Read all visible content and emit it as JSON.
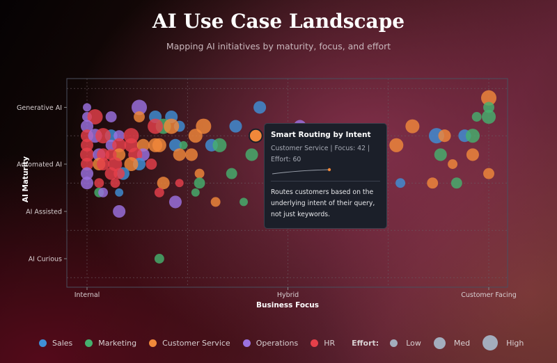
{
  "title": "AI Use Case Landscape",
  "subtitle": "Mapping AI initiatives by maturity, focus, and effort",
  "chart_data": {
    "type": "scatter",
    "title": "AI Use Case Landscape",
    "subtitle": "Mapping AI initiatives by maturity, focus, and effort",
    "xlabel": "Business Focus",
    "ylabel": "AI Maturity",
    "x_ticks": [
      {
        "value": 0,
        "label": "Internal"
      },
      {
        "value": 50,
        "label": "Hybrid"
      },
      {
        "value": 100,
        "label": "Customer Facing"
      }
    ],
    "y_ticks": [
      {
        "value": 1,
        "label": "AI Curious"
      },
      {
        "value": 2,
        "label": "AI Assisted"
      },
      {
        "value": 3,
        "label": "Automated AI"
      },
      {
        "value": 4.2,
        "label": "Generative AI"
      }
    ],
    "grid": true,
    "size_encoding": "effort",
    "colors": {
      "Sales": "#3f8fd6",
      "Marketing": "#45b06e",
      "Customer Service": "#f0883a",
      "Operations": "#9b72e0",
      "HR": "#e5404a"
    },
    "points": [
      {
        "dept": "Operations",
        "focus": 0,
        "maturity": 4.2,
        "effort": 22
      },
      {
        "dept": "Operations",
        "focus": 0,
        "maturity": 4.0,
        "effort": 33
      },
      {
        "dept": "HR",
        "focus": 2,
        "maturity": 4.0,
        "effort": 78
      },
      {
        "dept": "Operations",
        "focus": 6,
        "maturity": 4.0,
        "effort": 44
      },
      {
        "dept": "Operations",
        "focus": 13,
        "maturity": 4.2,
        "effort": 78
      },
      {
        "dept": "Customer Service",
        "focus": 13,
        "maturity": 4.0,
        "effort": 44
      },
      {
        "dept": "Sales",
        "focus": 17,
        "maturity": 4.0,
        "effort": 56
      },
      {
        "dept": "Sales",
        "focus": 21,
        "maturity": 4.0,
        "effort": 56
      },
      {
        "dept": "Sales",
        "focus": 43,
        "maturity": 4.2,
        "effort": 56
      },
      {
        "dept": "Operations",
        "focus": 0,
        "maturity": 3.8,
        "effort": 56
      },
      {
        "dept": "Sales",
        "focus": 23,
        "maturity": 3.8,
        "effort": 44
      },
      {
        "dept": "Marketing",
        "focus": 19,
        "maturity": 3.8,
        "effort": 78
      },
      {
        "dept": "HR",
        "focus": 17,
        "maturity": 3.8,
        "effort": 78
      },
      {
        "dept": "Customer Service",
        "focus": 21,
        "maturity": 3.8,
        "effort": 78
      },
      {
        "dept": "Customer Service",
        "focus": 29,
        "maturity": 3.8,
        "effort": 78
      },
      {
        "dept": "Sales",
        "focus": 37,
        "maturity": 3.8,
        "effort": 56
      },
      {
        "dept": "Operations",
        "focus": 53,
        "maturity": 3.8,
        "effort": 56
      },
      {
        "dept": "Customer Service",
        "focus": 27,
        "maturity": 3.6,
        "effort": 67
      },
      {
        "dept": "HR",
        "focus": 0,
        "maturity": 3.6,
        "effort": 56
      },
      {
        "dept": "Operations",
        "focus": 2,
        "maturity": 3.6,
        "effort": 67
      },
      {
        "dept": "Sales",
        "focus": 6,
        "maturity": 3.6,
        "effort": 56
      },
      {
        "dept": "HR",
        "focus": 4,
        "maturity": 3.6,
        "effort": 78
      },
      {
        "dept": "Operations",
        "focus": 8,
        "maturity": 3.6,
        "effort": 44
      },
      {
        "dept": "HR",
        "focus": 11,
        "maturity": 3.6,
        "effort": 78
      },
      {
        "dept": "HR",
        "focus": 0,
        "maturity": 3.4,
        "effort": 56
      },
      {
        "dept": "Operations",
        "focus": 6,
        "maturity": 3.4,
        "effort": 44
      },
      {
        "dept": "HR",
        "focus": 8,
        "maturity": 3.4,
        "effort": 67
      },
      {
        "dept": "HR",
        "focus": 11,
        "maturity": 3.4,
        "effort": 67
      },
      {
        "dept": "Customer Service",
        "focus": 14,
        "maturity": 3.4,
        "effort": 56
      },
      {
        "dept": "Customer Service",
        "focus": 17,
        "maturity": 3.4,
        "effort": 67
      },
      {
        "dept": "Customer Service",
        "focus": 18,
        "maturity": 3.4,
        "effort": 67
      },
      {
        "dept": "Sales",
        "focus": 22,
        "maturity": 3.4,
        "effort": 56
      },
      {
        "dept": "Marketing",
        "focus": 24,
        "maturity": 3.4,
        "effort": 22
      },
      {
        "dept": "Sales",
        "focus": 31,
        "maturity": 3.4,
        "effort": 56
      },
      {
        "dept": "Marketing",
        "focus": 33,
        "maturity": 3.4,
        "effort": 67
      },
      {
        "dept": "HR",
        "focus": 0,
        "maturity": 3.2,
        "effort": 67
      },
      {
        "dept": "Operations",
        "focus": 3,
        "maturity": 3.2,
        "effort": 56
      },
      {
        "dept": "HR",
        "focus": 4,
        "maturity": 3.2,
        "effort": 56
      },
      {
        "dept": "Customer Service",
        "focus": 8,
        "maturity": 3.2,
        "effort": 56
      },
      {
        "dept": "HR",
        "focus": 6,
        "maturity": 3.2,
        "effort": 44
      },
      {
        "dept": "Operations",
        "focus": 14,
        "maturity": 3.2,
        "effort": 56
      },
      {
        "dept": "HR",
        "focus": 12,
        "maturity": 3.2,
        "effort": 67
      },
      {
        "dept": "Customer Service",
        "focus": 23,
        "maturity": 3.2,
        "effort": 56
      },
      {
        "dept": "Customer Service",
        "focus": 26,
        "maturity": 3.2,
        "effort": 56
      },
      {
        "dept": "Marketing",
        "focus": 41,
        "maturity": 3.2,
        "effort": 56
      },
      {
        "dept": "HR",
        "focus": 0,
        "maturity": 3.0,
        "effort": 56
      },
      {
        "dept": "Customer Service",
        "focus": 3,
        "maturity": 3.0,
        "effort": 56
      },
      {
        "dept": "HR",
        "focus": 4,
        "maturity": 3.0,
        "effort": 56
      },
      {
        "dept": "HR",
        "focus": 7,
        "maturity": 3.0,
        "effort": 67
      },
      {
        "dept": "Sales",
        "focus": 13,
        "maturity": 3.0,
        "effort": 56
      },
      {
        "dept": "Customer Service",
        "focus": 11,
        "maturity": 3.0,
        "effort": 67
      },
      {
        "dept": "HR",
        "focus": 16,
        "maturity": 3.0,
        "effort": 44
      },
      {
        "dept": "Operations",
        "focus": 0,
        "maturity": 2.8,
        "effort": 56
      },
      {
        "dept": "Sales",
        "focus": 9,
        "maturity": 2.8,
        "effort": 56
      },
      {
        "dept": "HR",
        "focus": 6,
        "maturity": 2.8,
        "effort": 56
      },
      {
        "dept": "HR",
        "focus": 8,
        "maturity": 2.8,
        "effort": 44
      },
      {
        "dept": "Customer Service",
        "focus": 28,
        "maturity": 2.8,
        "effort": 33
      },
      {
        "dept": "Marketing",
        "focus": 36,
        "maturity": 2.8,
        "effort": 44
      },
      {
        "dept": "Operations",
        "focus": 0,
        "maturity": 2.6,
        "effort": 56
      },
      {
        "dept": "HR",
        "focus": 3,
        "maturity": 2.6,
        "effort": 33
      },
      {
        "dept": "HR",
        "focus": 7,
        "maturity": 2.6,
        "effort": 33
      },
      {
        "dept": "Customer Service",
        "focus": 19,
        "maturity": 2.6,
        "effort": 56
      },
      {
        "dept": "HR",
        "focus": 23,
        "maturity": 2.6,
        "effort": 22
      },
      {
        "dept": "Marketing",
        "focus": 28,
        "maturity": 2.6,
        "effort": 44
      },
      {
        "dept": "Marketing",
        "focus": 3,
        "maturity": 2.4,
        "effort": 33
      },
      {
        "dept": "Operations",
        "focus": 4,
        "maturity": 2.4,
        "effort": 33
      },
      {
        "dept": "Sales",
        "focus": 8,
        "maturity": 2.4,
        "effort": 22
      },
      {
        "dept": "HR",
        "focus": 18,
        "maturity": 2.4,
        "effort": 33
      },
      {
        "dept": "Marketing",
        "focus": 27,
        "maturity": 2.4,
        "effort": 22
      },
      {
        "dept": "Operations",
        "focus": 22,
        "maturity": 2.2,
        "effort": 56
      },
      {
        "dept": "Customer Service",
        "focus": 32,
        "maturity": 2.2,
        "effort": 33
      },
      {
        "dept": "Marketing",
        "focus": 39,
        "maturity": 2.2,
        "effort": 22
      },
      {
        "dept": "Operations",
        "focus": 8,
        "maturity": 2.0,
        "effort": 56
      },
      {
        "dept": "Marketing",
        "focus": 18,
        "maturity": 1.0,
        "effort": 33
      },
      {
        "dept": "Customer Service",
        "focus": 100,
        "maturity": 4.4,
        "effort": 78
      },
      {
        "dept": "Marketing",
        "focus": 100,
        "maturity": 4.2,
        "effort": 44
      },
      {
        "dept": "Marketing",
        "focus": 97,
        "maturity": 4.0,
        "effort": 33
      },
      {
        "dept": "Marketing",
        "focus": 100,
        "maturity": 4.0,
        "effort": 67
      },
      {
        "dept": "Customer Service",
        "focus": 81,
        "maturity": 3.8,
        "effort": 67
      },
      {
        "dept": "Sales",
        "focus": 87,
        "maturity": 3.6,
        "effort": 78
      },
      {
        "dept": "Customer Service",
        "focus": 89,
        "maturity": 3.6,
        "effort": 56
      },
      {
        "dept": "Sales",
        "focus": 94,
        "maturity": 3.6,
        "effort": 56
      },
      {
        "dept": "Marketing",
        "focus": 96,
        "maturity": 3.6,
        "effort": 67
      },
      {
        "dept": "Customer Service",
        "focus": 77,
        "maturity": 3.4,
        "effort": 67
      },
      {
        "dept": "Marketing",
        "focus": 88,
        "maturity": 3.2,
        "effort": 56
      },
      {
        "dept": "Customer Service",
        "focus": 96,
        "maturity": 3.2,
        "effort": 56
      },
      {
        "dept": "Customer Service",
        "focus": 91,
        "maturity": 3.0,
        "effort": 33
      },
      {
        "dept": "Customer Service",
        "focus": 100,
        "maturity": 2.8,
        "effort": 44
      },
      {
        "dept": "Sales",
        "focus": 78,
        "maturity": 2.6,
        "effort": 33
      },
      {
        "dept": "Customer Service",
        "focus": 86,
        "maturity": 2.6,
        "effort": 44
      },
      {
        "dept": "Marketing",
        "focus": 92,
        "maturity": 2.6,
        "effort": 44
      },
      {
        "dept": "Customer Service",
        "focus": 42,
        "maturity": 3.6,
        "effort": 60,
        "name": "Smart Routing by Intent",
        "highlighted": true
      }
    ]
  },
  "tooltip": {
    "title": "Smart Routing by Intent",
    "meta": "Customer Service | Focus: 42 | Effort: 60",
    "description": "Routes customers based on the underlying intent of their query, not just keywords."
  },
  "legend": {
    "departments": [
      {
        "label": "Sales",
        "color": "#3f8fd6"
      },
      {
        "label": "Marketing",
        "color": "#45b06e"
      },
      {
        "label": "Customer Service",
        "color": "#f0883a"
      },
      {
        "label": "Operations",
        "color": "#9b72e0"
      },
      {
        "label": "HR",
        "color": "#e5404a"
      }
    ],
    "effort_title": "Effort:",
    "effort_levels": [
      {
        "label": "Low",
        "effort": 20
      },
      {
        "label": "Med",
        "effort": 60
      },
      {
        "label": "High",
        "effort": 100
      }
    ],
    "effort_color": "#a3adbd"
  }
}
